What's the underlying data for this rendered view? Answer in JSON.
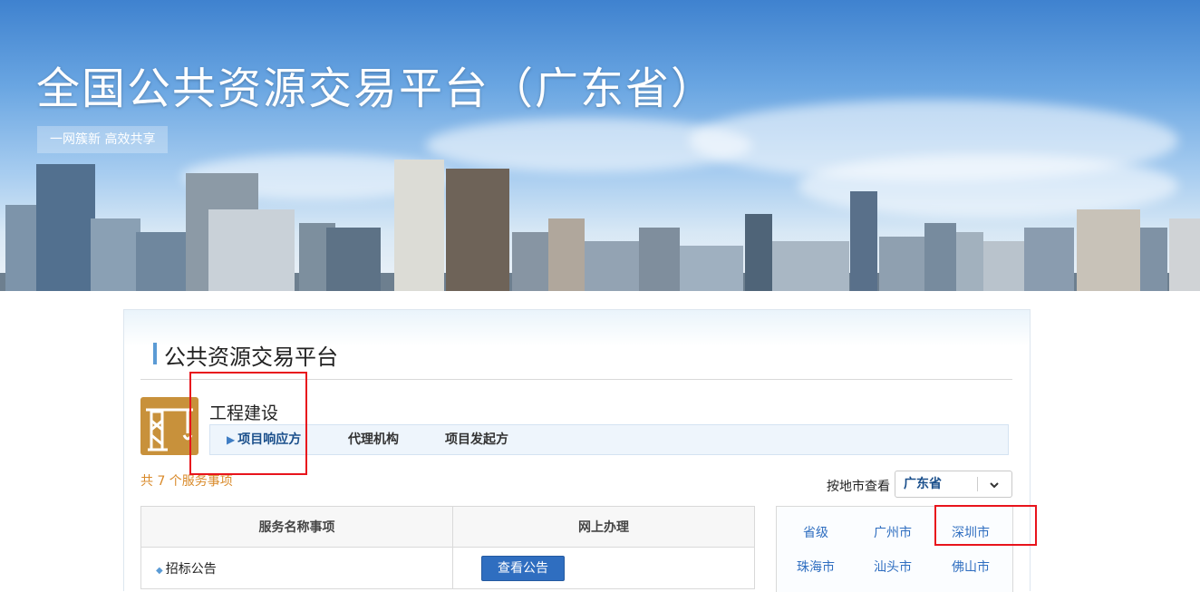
{
  "banner": {
    "title": "全国公共资源交易平台（广东省）",
    "slogan": "一网簇新 高效共享"
  },
  "section": {
    "title": "公共资源交易平台"
  },
  "category": {
    "name": "工程建设",
    "icon": "crane-icon",
    "tabs": [
      {
        "label": "项目响应方",
        "active": true
      },
      {
        "label": "代理机构",
        "active": false
      },
      {
        "label": "项目发起方",
        "active": false
      }
    ]
  },
  "service_count": "共 7 个服务事项",
  "region_filter": {
    "label": "按地市查看",
    "selected": "广东省"
  },
  "service_table": {
    "headers": [
      "服务名称事项",
      "网上办理"
    ],
    "rows": [
      {
        "name": "招标公告",
        "action": "查看公告"
      }
    ]
  },
  "cities": [
    "省级",
    "广州市",
    "深圳市",
    "珠海市",
    "汕头市",
    "佛山市"
  ],
  "colors": {
    "annotation": "#e8141c",
    "accent": "#2f6ec0",
    "count": "#d98a2a",
    "icon_bg": "#c8913b"
  }
}
